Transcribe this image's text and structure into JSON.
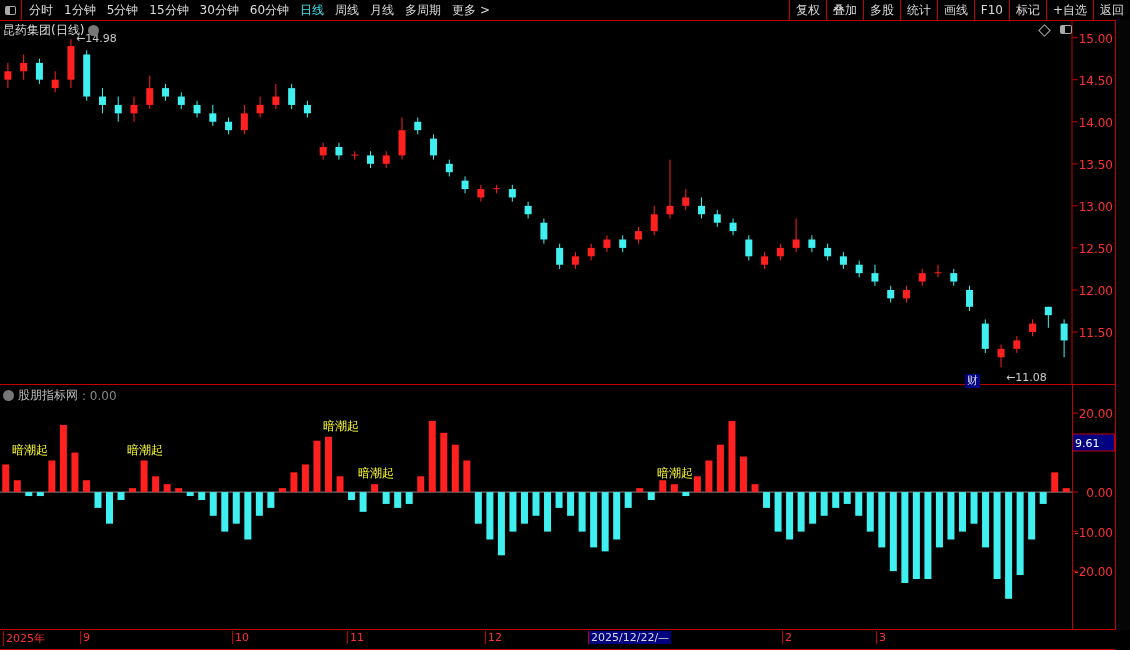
{
  "toolbar": {
    "tabs": [
      {
        "label": "分时",
        "selected": false
      },
      {
        "label": "1分钟",
        "selected": false
      },
      {
        "label": "5分钟",
        "selected": false
      },
      {
        "label": "15分钟",
        "selected": false
      },
      {
        "label": "30分钟",
        "selected": false
      },
      {
        "label": "60分钟",
        "selected": false
      },
      {
        "label": "日线",
        "selected": true
      },
      {
        "label": "周线",
        "selected": false
      },
      {
        "label": "月线",
        "selected": false
      },
      {
        "label": "多周期",
        "selected": false
      },
      {
        "label": "更多 >",
        "selected": false
      }
    ],
    "buttons": [
      "复权",
      "叠加",
      "多股",
      "统计",
      "画线",
      "F10",
      "标记",
      "+自选",
      "返回"
    ]
  },
  "price_panel": {
    "title": "昆药集团(日线)",
    "badge": "财",
    "chart_data": {
      "type": "candlestick",
      "categories": [
        null,
        null,
        null,
        null,
        null,
        null,
        null,
        null,
        null,
        null,
        null,
        null,
        null,
        null,
        null,
        null,
        null,
        null,
        null,
        null,
        null,
        null,
        null,
        null,
        null,
        null,
        null,
        null,
        null,
        null,
        null,
        null,
        null,
        null,
        null,
        null,
        null,
        null,
        null,
        null,
        null,
        null,
        null,
        null,
        null,
        null,
        null,
        null,
        null,
        null,
        null,
        null,
        null,
        null,
        null,
        null,
        null,
        null,
        null,
        null,
        null,
        null,
        null,
        null,
        null,
        null,
        null,
        null
      ],
      "ylim": [
        10.87,
        15.21
      ],
      "yticks": [
        {
          "value": 15,
          "label": "15.00"
        },
        {
          "value": 14.5,
          "label": "14.50"
        },
        {
          "value": 14,
          "label": "14.00"
        },
        {
          "value": 13.5,
          "label": "13.50"
        },
        {
          "value": 13,
          "label": "13.00"
        },
        {
          "value": 12.5,
          "label": "12.50"
        },
        {
          "value": 12,
          "label": "12.00"
        },
        {
          "value": 11.5,
          "label": "11.50"
        }
      ],
      "ohlc": [
        [
          14.5,
          14.7,
          14.4,
          14.6
        ],
        [
          14.6,
          14.8,
          14.5,
          14.7
        ],
        [
          14.7,
          14.75,
          14.45,
          14.5
        ],
        [
          14.4,
          14.6,
          14.35,
          14.5
        ],
        [
          14.5,
          14.98,
          14.4,
          14.9
        ],
        [
          14.8,
          14.85,
          14.25,
          14.3
        ],
        [
          14.3,
          14.4,
          14.1,
          14.2
        ],
        [
          14.2,
          14.3,
          14.0,
          14.1
        ],
        [
          14.1,
          14.3,
          14.0,
          14.2
        ],
        [
          14.2,
          14.55,
          14.15,
          14.4
        ],
        [
          14.4,
          14.45,
          14.25,
          14.3
        ],
        [
          14.3,
          14.35,
          14.15,
          14.2
        ],
        [
          14.2,
          14.25,
          14.05,
          14.1
        ],
        [
          14.1,
          14.2,
          13.95,
          14.0
        ],
        [
          14.0,
          14.05,
          13.85,
          13.9
        ],
        [
          13.9,
          14.2,
          13.85,
          14.1
        ],
        [
          14.1,
          14.3,
          14.05,
          14.2
        ],
        [
          14.2,
          14.45,
          14.15,
          14.3
        ],
        [
          14.4,
          14.45,
          14.15,
          14.2
        ],
        [
          14.2,
          14.25,
          14.05,
          14.1
        ],
        [
          13.6,
          13.75,
          13.55,
          13.7
        ],
        [
          13.7,
          13.75,
          13.55,
          13.6
        ],
        [
          13.6,
          13.65,
          13.55,
          13.61
        ],
        [
          13.6,
          13.65,
          13.45,
          13.5
        ],
        [
          13.5,
          13.65,
          13.45,
          13.6
        ],
        [
          13.6,
          14.05,
          13.55,
          13.9
        ],
        [
          14.0,
          14.05,
          13.85,
          13.9
        ],
        [
          13.8,
          13.85,
          13.55,
          13.6
        ],
        [
          13.5,
          13.55,
          13.35,
          13.4
        ],
        [
          13.3,
          13.35,
          13.15,
          13.2
        ],
        [
          13.1,
          13.25,
          13.05,
          13.2
        ],
        [
          13.2,
          13.25,
          13.15,
          13.21
        ],
        [
          13.2,
          13.25,
          13.05,
          13.1
        ],
        [
          13.0,
          13.05,
          12.85,
          12.9
        ],
        [
          12.8,
          12.85,
          12.55,
          12.6
        ],
        [
          12.5,
          12.55,
          12.25,
          12.3
        ],
        [
          12.3,
          12.45,
          12.25,
          12.4
        ],
        [
          12.4,
          12.55,
          12.35,
          12.5
        ],
        [
          12.5,
          12.65,
          12.45,
          12.6
        ],
        [
          12.6,
          12.65,
          12.45,
          12.5
        ],
        [
          12.6,
          12.75,
          12.55,
          12.7
        ],
        [
          12.7,
          13.0,
          12.65,
          12.9
        ],
        [
          12.9,
          13.55,
          12.85,
          13.0
        ],
        [
          13.0,
          13.2,
          12.95,
          13.1
        ],
        [
          13.0,
          13.1,
          12.85,
          12.9
        ],
        [
          12.9,
          12.95,
          12.75,
          12.8
        ],
        [
          12.8,
          12.85,
          12.65,
          12.7
        ],
        [
          12.6,
          12.65,
          12.35,
          12.4
        ],
        [
          12.3,
          12.45,
          12.25,
          12.4
        ],
        [
          12.4,
          12.55,
          12.35,
          12.5
        ],
        [
          12.5,
          12.85,
          12.45,
          12.6
        ],
        [
          12.6,
          12.65,
          12.45,
          12.5
        ],
        [
          12.5,
          12.55,
          12.35,
          12.4
        ],
        [
          12.4,
          12.45,
          12.25,
          12.3
        ],
        [
          12.3,
          12.35,
          12.15,
          12.2
        ],
        [
          12.2,
          12.3,
          12.05,
          12.1
        ],
        [
          12.0,
          12.05,
          11.85,
          11.9
        ],
        [
          11.9,
          12.05,
          11.85,
          12.0
        ],
        [
          12.1,
          12.25,
          12.05,
          12.2
        ],
        [
          12.2,
          12.3,
          12.15,
          12.21
        ],
        [
          12.2,
          12.25,
          12.05,
          12.1
        ],
        [
          12.0,
          12.05,
          11.75,
          11.8
        ],
        [
          11.6,
          11.65,
          11.25,
          11.3
        ],
        [
          11.2,
          11.35,
          11.08,
          11.3
        ],
        [
          11.3,
          11.45,
          11.25,
          11.4
        ],
        [
          11.5,
          11.65,
          11.45,
          11.6
        ],
        [
          11.8,
          11.8,
          11.55,
          11.7
        ],
        [
          11.6,
          11.65,
          11.2,
          11.4
        ]
      ],
      "annotations": [
        "←14.98",
        "←11.08"
      ]
    }
  },
  "indicator_panel": {
    "name": "股朋指标网",
    "value": ": 0.00",
    "crosshair_value": "9.61",
    "chart_data": {
      "type": "bar",
      "stacked": true,
      "categories": [
        null,
        null,
        null,
        null,
        null,
        null,
        null,
        null,
        null,
        null,
        null,
        null,
        null,
        null,
        null,
        null,
        null,
        null,
        null,
        null,
        null,
        null,
        null,
        null,
        null,
        null,
        null,
        null,
        null,
        null,
        null,
        null,
        null,
        null,
        null,
        null,
        null,
        null,
        null,
        null,
        null,
        null,
        null,
        null,
        null,
        null,
        null,
        null,
        null,
        null,
        null,
        null,
        null,
        null,
        null,
        null,
        null,
        null,
        null,
        null,
        null,
        null,
        null,
        null,
        null,
        null,
        null,
        null,
        null,
        null,
        null,
        null,
        null,
        null,
        null,
        null,
        null,
        null,
        null,
        null,
        null,
        null,
        null,
        null,
        null,
        null,
        null,
        null,
        null,
        null,
        null,
        null,
        null
      ],
      "ylim": [
        -34.9,
        27.1
      ],
      "yticks": [
        {
          "value": 20,
          "label": "20.00"
        },
        {
          "value": 0,
          "label": "0.00"
        },
        {
          "value": -10,
          "label": "-10.00"
        },
        {
          "value": -20,
          "label": "-20.00"
        }
      ],
      "series": [
        {
          "color": "#ff2020",
          "values": [
            7,
            3,
            0,
            0,
            8,
            17,
            10,
            3,
            0,
            0,
            0,
            1,
            8,
            4,
            2,
            1,
            0,
            0,
            0,
            0,
            0,
            0,
            0,
            0,
            1,
            5,
            7,
            13,
            14,
            4,
            0,
            0,
            2,
            0,
            0,
            0,
            4,
            18,
            15,
            12,
            8,
            0,
            0,
            0,
            0,
            0,
            0,
            0,
            0,
            0,
            0,
            0,
            0,
            0,
            0,
            1,
            0,
            3,
            2,
            0,
            4,
            8,
            12,
            18,
            9,
            2,
            0,
            0,
            0,
            0,
            0,
            0,
            0,
            0,
            0,
            0,
            0,
            0,
            0,
            0,
            0,
            0,
            0,
            0,
            0,
            0,
            0,
            0,
            0,
            0,
            0,
            5,
            1
          ]
        },
        {
          "color": "#40f0f0",
          "values": [
            0,
            0,
            -1,
            -1,
            0,
            0,
            0,
            0,
            -4,
            -8,
            -2,
            0,
            0,
            0,
            0,
            0,
            -1,
            -2,
            -6,
            -10,
            -8,
            -12,
            -6,
            -4,
            0,
            0,
            0,
            0,
            0,
            0,
            -2,
            -5,
            0,
            -3,
            -4,
            -3,
            0,
            0,
            0,
            0,
            0,
            -8,
            -12,
            -16,
            -10,
            -8,
            -6,
            -10,
            -4,
            -6,
            -10,
            -14,
            -15,
            -12,
            -4,
            0,
            -2,
            0,
            0,
            -1,
            0,
            0,
            0,
            0,
            0,
            0,
            -4,
            -10,
            -12,
            -10,
            -8,
            -6,
            -4,
            -3,
            -6,
            -10,
            -14,
            -20,
            -23,
            -22,
            -22,
            -14,
            -12,
            -10,
            -8,
            -14,
            -22,
            -27,
            -21,
            -12,
            -3,
            0,
            0
          ]
        }
      ],
      "annotations": [
        "暗潮起",
        "暗潮起",
        "暗潮起",
        "暗潮起",
        "暗潮起"
      ]
    }
  },
  "time_axis": [
    {
      "label": "2025年",
      "selected": false
    },
    {
      "label": "9",
      "selected": false
    },
    {
      "label": "10",
      "selected": false
    },
    {
      "label": "11",
      "selected": false
    },
    {
      "label": "12",
      "selected": false
    },
    {
      "label": "2025/12/22/—",
      "selected": true
    },
    {
      "label": "2",
      "selected": false
    },
    {
      "label": "3",
      "selected": false
    }
  ]
}
